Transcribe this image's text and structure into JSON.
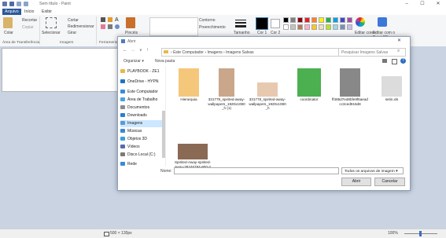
{
  "app": {
    "title": "Sem título - Paint",
    "tabs": [
      "Arquivo",
      "Início",
      "Exibir"
    ]
  },
  "ribbon": {
    "paste": "Colar",
    "cut": "Recortar",
    "copy": "Copiar",
    "select": "Selecionar",
    "crop": "Cortar",
    "resize": "Redimensionar",
    "rotate": "Girar",
    "brushes": "Pincéis",
    "outline": "Contorno",
    "fill": "Preenchimento",
    "size": "Tamanho",
    "color1": "Cor 1",
    "color2": "Cor 2",
    "edit_colors": "Editar cores",
    "paint3d": "Editar com o Paint 3D",
    "group_clipboard": "Área de Transferência",
    "group_image": "Imagem",
    "group_tools": "Ferramentas",
    "palette": [
      "#000000",
      "#7f7f7f",
      "#880015",
      "#ed1c24",
      "#ff7f27",
      "#fff200",
      "#22b14c",
      "#00a2e8",
      "#3f48cc",
      "#a349a4",
      "#ffffff",
      "#c3c3c3",
      "#b97a57",
      "#ffaec9",
      "#ffc90e",
      "#efe4b0",
      "#b5e61d",
      "#99d9ea",
      "#7092be",
      "#c8bfe7"
    ]
  },
  "status": {
    "canvas_size": "500 × 130px",
    "zoom": "100%"
  },
  "dialog": {
    "title": "Abrir",
    "path": [
      "Este Computador",
      "Imagens",
      "Imagens Salvas"
    ],
    "search_placeholder": "Pesquisar Imagens Salvas",
    "organize": "Organizar",
    "new_folder": "Nova pasta",
    "nav": [
      {
        "label": "PLAYBOOK - ZE1",
        "icon": "folder-icon",
        "color": "#e8b84a"
      },
      {
        "label": "OneDrive - HYPN",
        "icon": "cloud-icon",
        "color": "#1e72c4"
      },
      {
        "label": "Este Computador",
        "icon": "computer-icon",
        "color": "#3b8ad8"
      },
      {
        "label": "Área de Trabalho",
        "icon": "desktop-icon",
        "color": "#4aa3df"
      },
      {
        "label": "Documentos",
        "icon": "documents-icon",
        "color": "#8c8c8c"
      },
      {
        "label": "Downloads",
        "icon": "download-icon",
        "color": "#2a7fd4"
      },
      {
        "label": "Imagens",
        "icon": "pictures-icon",
        "color": "#5a9bd5"
      },
      {
        "label": "Músicas",
        "icon": "music-icon",
        "color": "#3c87d0"
      },
      {
        "label": "Objetos 3D",
        "icon": "objects3d-icon",
        "color": "#3aa0d8"
      },
      {
        "label": "Vídeos",
        "icon": "video-icon",
        "color": "#556bb0"
      },
      {
        "label": "Disco Local (C:)",
        "icon": "drive-icon",
        "color": "#7a7a7a"
      },
      {
        "label": "Rede",
        "icon": "network-icon",
        "color": "#3b8ad8"
      }
    ],
    "files": [
      {
        "label": "Hierarquia",
        "thumb": "person-thumbnail",
        "color": "#f4c77b"
      },
      {
        "label": "331778_spirited-away-wallpapers_1920x1080_h (1)",
        "thumb": "anime-thumbnail",
        "color": "#caa68a"
      },
      {
        "label": "331778_spirited-away-wallpapers_1920x1080_h",
        "thumb": "anime-thumbnail",
        "color": "#e7c9b0"
      },
      {
        "label": "coordinator",
        "thumb": "avatar-thumbnail",
        "color": "#4caf50"
      },
      {
        "label": "ff485d7ed8bfe9f6aeadcc3ced916d8",
        "thumb": "manga-thumbnail",
        "color": "#888888"
      },
      {
        "label": "setin.xls",
        "thumb": "sheet-thumbnail",
        "color": "#dcdcdc"
      },
      {
        "label": "Spirited-Away-spirited-away-39246794-900-475",
        "thumb": "landscape-thumbnail",
        "color": "#8a6a55"
      }
    ],
    "name_label": "Nome:",
    "name_value": "",
    "filter": "Todos os arquivos de imagem",
    "open": "Abrir",
    "cancel": "Cancelar"
  }
}
